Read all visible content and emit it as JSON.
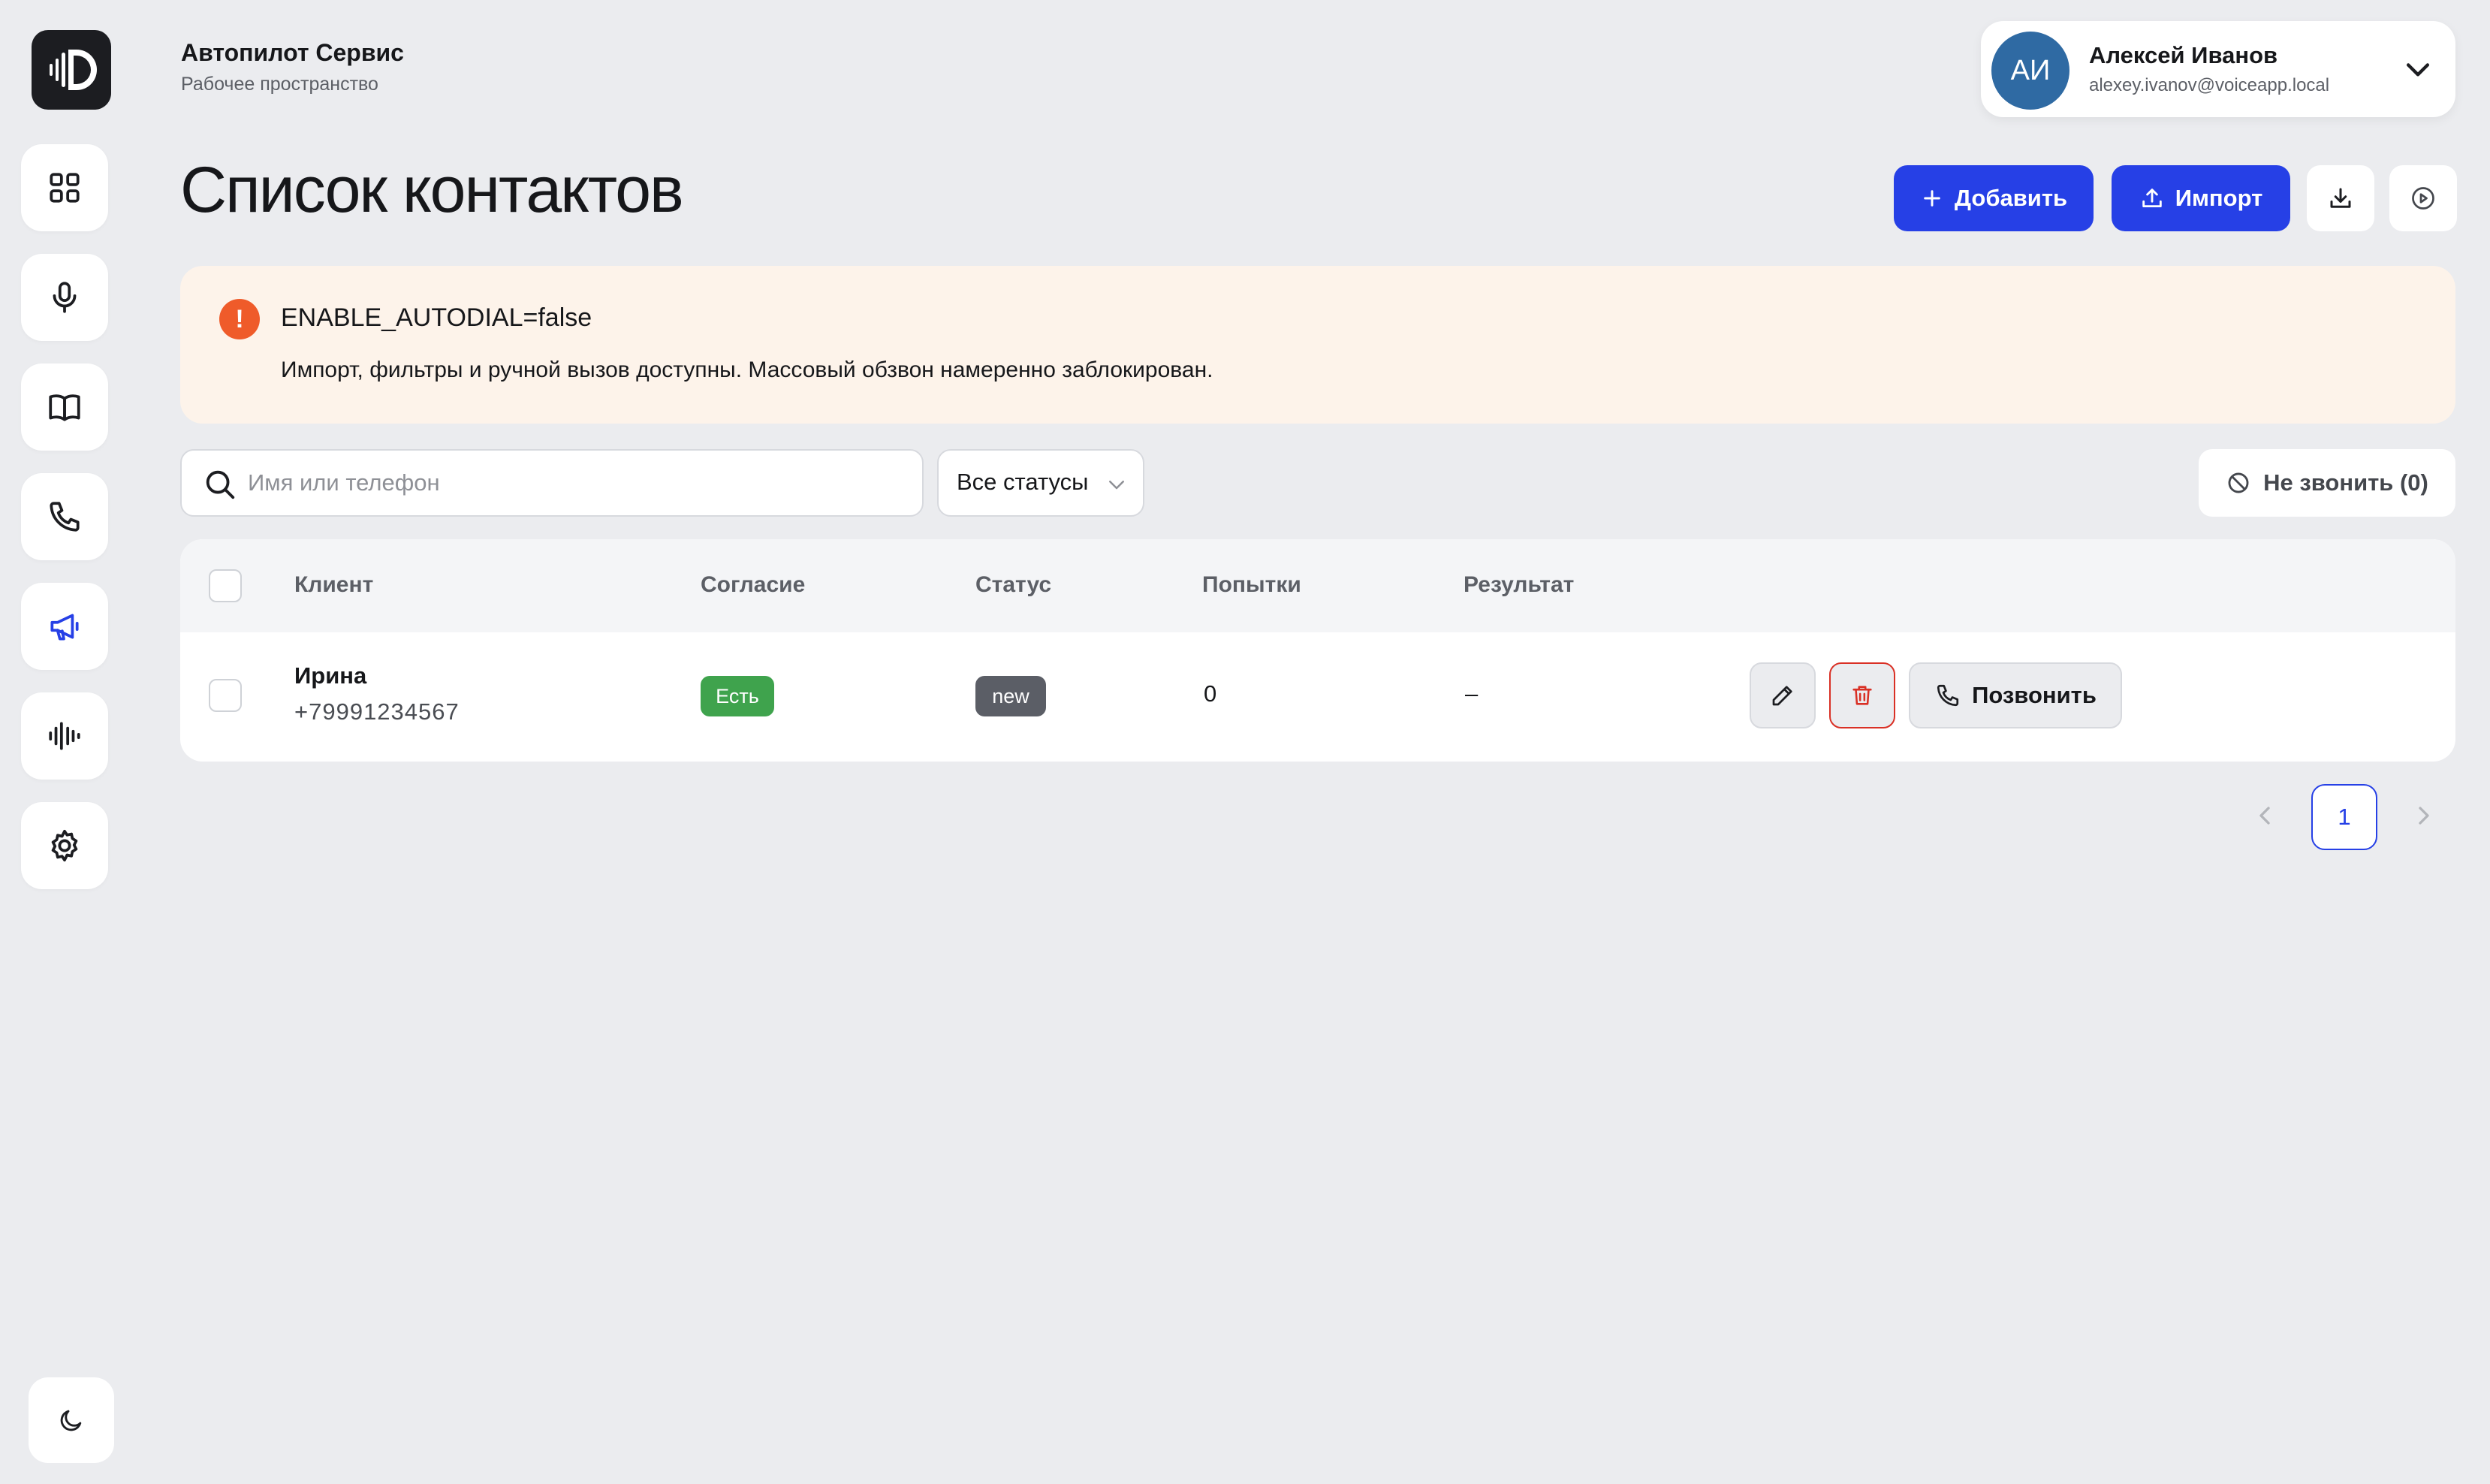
{
  "workspace": {
    "title": "Автопилот Сервис",
    "subtitle": "Рабочее пространство"
  },
  "user": {
    "initials": "АИ",
    "name": "Алексей Иванов",
    "email": "alexey.ivanov@voiceapp.local"
  },
  "sidebar": {
    "items": [
      {
        "icon": "dashboard-grid-icon"
      },
      {
        "icon": "microphone-icon"
      },
      {
        "icon": "book-icon"
      },
      {
        "icon": "phone-icon"
      },
      {
        "icon": "megaphone-icon",
        "active": true
      },
      {
        "icon": "voice-wave-icon"
      },
      {
        "icon": "gear-icon"
      }
    ],
    "theme_icon": "moon-icon"
  },
  "page": {
    "title": "Список контактов"
  },
  "toolbar": {
    "add_label": "Добавить",
    "import_label": "Импорт",
    "download_icon": "download-icon",
    "play_icon": "play-circle-icon"
  },
  "alert": {
    "title": "ENABLE_AUTODIAL=false",
    "text": "Импорт, фильтры и ручной вызов доступны. Массовый обзвон намеренно заблокирован."
  },
  "filters": {
    "search_placeholder": "Имя или телефон",
    "status_selected": "Все статусы",
    "dnc_label": "Не звонить (0)"
  },
  "table": {
    "columns": [
      "Клиент",
      "Согласие",
      "Статус",
      "Попытки",
      "Результат"
    ],
    "rows": [
      {
        "name": "Ирина",
        "phone": "+79991234567",
        "consent": "Есть",
        "status": "new",
        "attempts": "0",
        "result": "–",
        "call_label": "Позвонить"
      }
    ]
  },
  "pagination": {
    "current": "1"
  },
  "colors": {
    "accent": "#2640e6",
    "consent_badge": "#3fa34d",
    "status_badge": "#5b5e66",
    "alert_bg": "#fdf3ea",
    "alert_icon": "#ef5b2a",
    "danger": "#d93025"
  }
}
